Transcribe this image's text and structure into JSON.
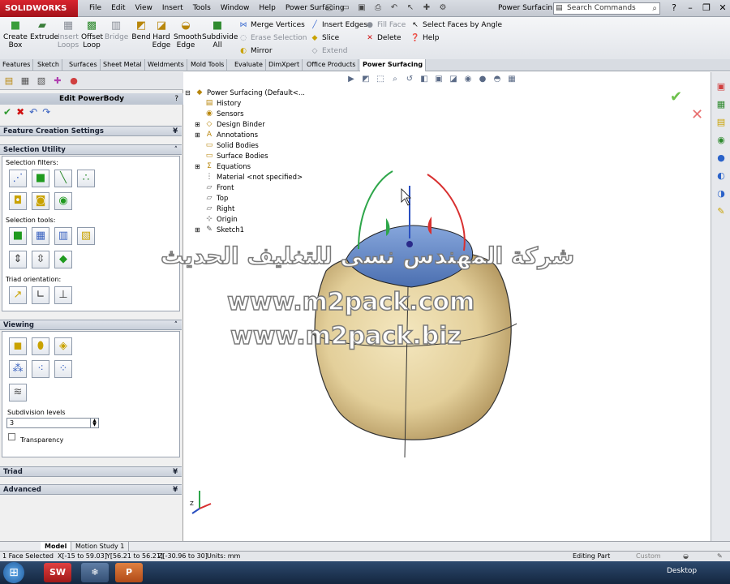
{
  "app": {
    "logo": "SOLIDWORKS",
    "menus": [
      "File",
      "Edit",
      "View",
      "Insert",
      "Tools",
      "Window",
      "Help",
      "Power Surfacing"
    ],
    "doc_title": "Power Surfacin...",
    "search_placeholder": "Search Commands"
  },
  "ribbon": {
    "create_box": "Create Box",
    "extrude": "Extrude",
    "insert_loops": "Insert Loops",
    "offset_loop": "Offset Loop",
    "bridge": "Bridge",
    "bend": "Bend",
    "hard_edge": "Hard Edge",
    "smooth_edge": "Smooth Edge",
    "subdivide_all": "Subdivide All",
    "merge_vertices": "Merge Vertices",
    "erase_selection": "Erase Selection",
    "mirror": "Mirror",
    "insert_edges": "Insert Edges",
    "slice": "Slice",
    "extend": "Extend",
    "fill_face": "Fill Face",
    "delete": "Delete",
    "select_faces_by_angle": "Select Faces by Angle",
    "help": "Help"
  },
  "tabs": [
    "Features",
    "Sketch",
    "Surfaces",
    "Sheet Metal",
    "Weldments",
    "Mold Tools",
    "Evaluate",
    "DimXpert",
    "Office Products",
    "Power Surfacing"
  ],
  "panel": {
    "title": "Edit PowerBody",
    "help": "?",
    "feature_creation": "Feature Creation Settings",
    "selection_utility": "Selection Utility",
    "selection_filters": "Selection filters:",
    "selection_tools": "Selection tools:",
    "triad_orientation": "Triad orientation:",
    "viewing": "Viewing",
    "subdivision_levels": "Subdivision levels",
    "subdivision_value": "3",
    "transparency": "Transparency",
    "triad": "Triad",
    "advanced": "Advanced"
  },
  "tree": {
    "root": "Power Surfacing  (Default<...",
    "items": [
      "History",
      "Sensors",
      "Design Binder",
      "Annotations",
      "Solid Bodies",
      "Surface Bodies",
      "Equations",
      "Material <not specified>",
      "Front",
      "Top",
      "Right",
      "Origin",
      "Sketch1"
    ]
  },
  "watermark": {
    "arabic": "شركة المهندس نسى للتغليف الحديث",
    "url1": "www.m2pack.com",
    "url2": "www.m2pack.biz"
  },
  "bottom_tabs": [
    "Model",
    "Motion Study 1"
  ],
  "status": {
    "selection": "1 Face Selected",
    "x": "X[-15 to 59.03]",
    "y": "Y[56.21 to 56.21]",
    "z": "Z[-30.96 to 30]",
    "units": "Units: mm",
    "mode": "Editing Part",
    "custom": "Custom"
  },
  "taskbar": {
    "desktop": "Desktop",
    "sw": "SW"
  },
  "colors": {
    "accent": "#d8242e",
    "surface": "#e3cf9a",
    "face_selected": "#6d8fc8"
  }
}
